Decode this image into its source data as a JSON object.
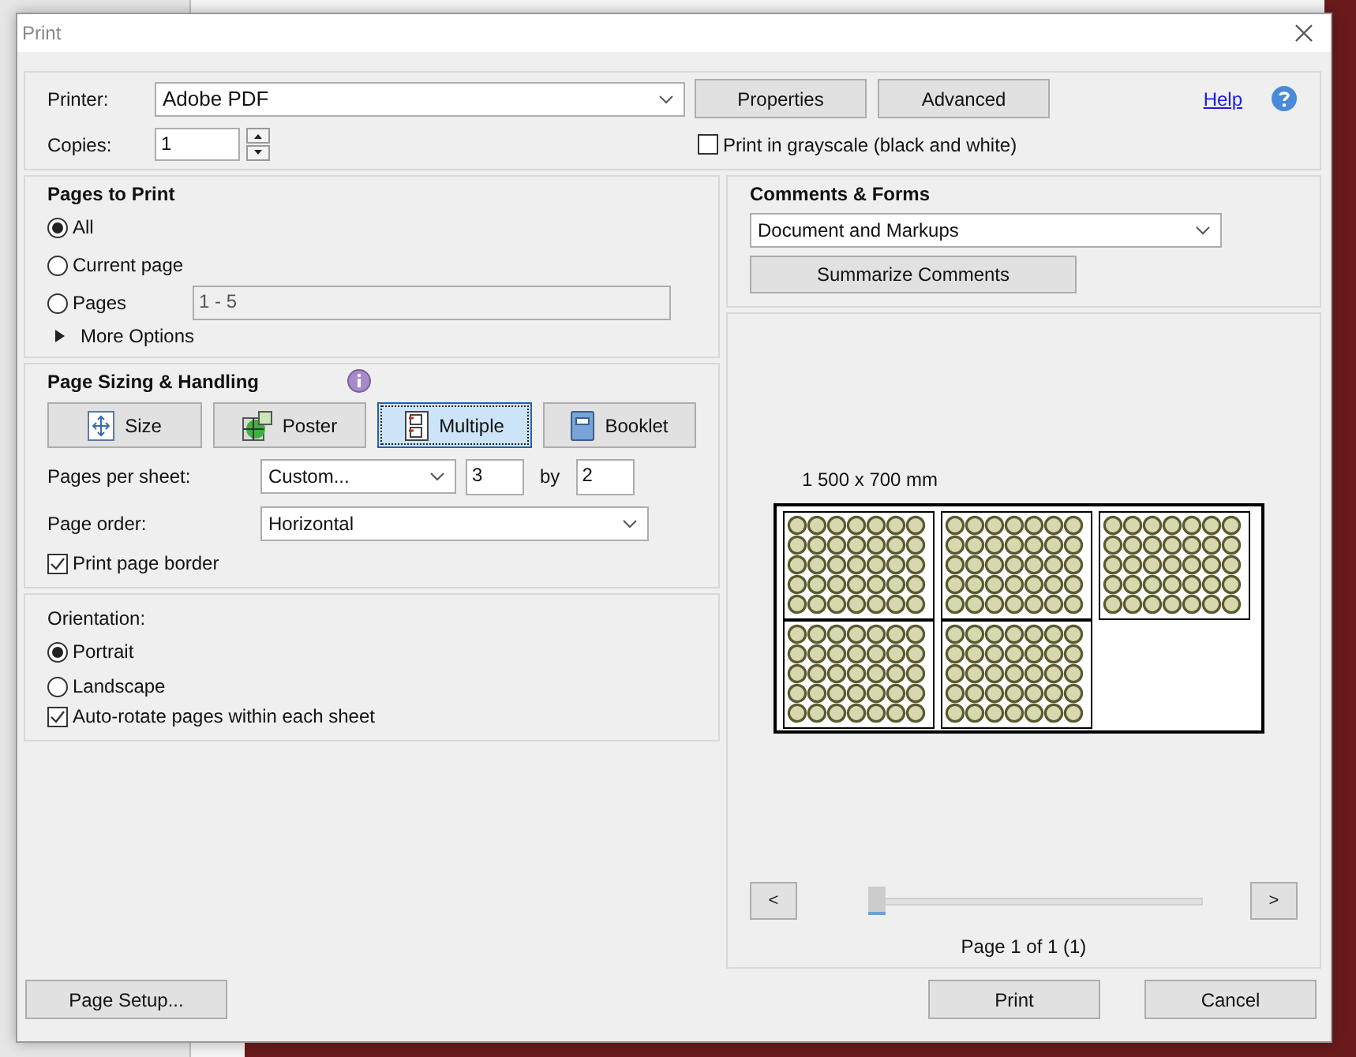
{
  "window": {
    "title": "Print"
  },
  "printer": {
    "label": "Printer:",
    "value": "Adobe PDF"
  },
  "top_buttons": [
    "Properties",
    "Advanced"
  ],
  "help": {
    "label": "Help"
  },
  "copies": {
    "label": "Copies:",
    "value": "1"
  },
  "grayscale": {
    "label": "Print in grayscale (black and white)",
    "checked": false
  },
  "pages_to_print": {
    "title": "Pages to Print",
    "options": [
      {
        "label": "All",
        "selected": true
      },
      {
        "label": "Current page",
        "selected": false
      },
      {
        "label": "Pages",
        "selected": false
      }
    ],
    "range": {
      "value": "1 - 5",
      "disabled": true
    },
    "more_options": {
      "label": "More Options",
      "expanded": false
    }
  },
  "page_sizing": {
    "title": "Page Sizing & Handling",
    "modes": [
      {
        "label": "Size",
        "kind": "size",
        "selected": false
      },
      {
        "label": "Poster",
        "kind": "poster",
        "selected": false
      },
      {
        "label": "Multiple",
        "kind": "multiple",
        "selected": true
      },
      {
        "label": "Booklet",
        "kind": "booklet",
        "selected": false
      }
    ],
    "pages_per_sheet": {
      "label": "Pages per sheet:",
      "value": "Custom...",
      "columns": "3",
      "by": "by",
      "rows": "2"
    },
    "page_order": {
      "label": "Page order:",
      "value": "Horizontal"
    },
    "print_page_border": {
      "label": "Print page border",
      "checked": true
    }
  },
  "orientation": {
    "title": "Orientation:",
    "options": [
      {
        "label": "Portrait",
        "selected": true
      },
      {
        "label": "Landscape",
        "selected": false
      }
    ],
    "auto_rotate": {
      "label": "Auto-rotate pages within each sheet",
      "checked": true
    }
  },
  "comments_forms": {
    "title": "Comments & Forms",
    "value": "Document and Markups",
    "summarize": "Summarize Comments"
  },
  "preview": {
    "size": "1 500 x 700 mm",
    "prev": "<",
    "next": ">",
    "slider": {
      "level": 0
    },
    "page_label": "Page 1 of 1 (1)"
  },
  "footer": {
    "page_setup": "Page Setup...",
    "print": "Print",
    "cancel": "Cancel"
  }
}
